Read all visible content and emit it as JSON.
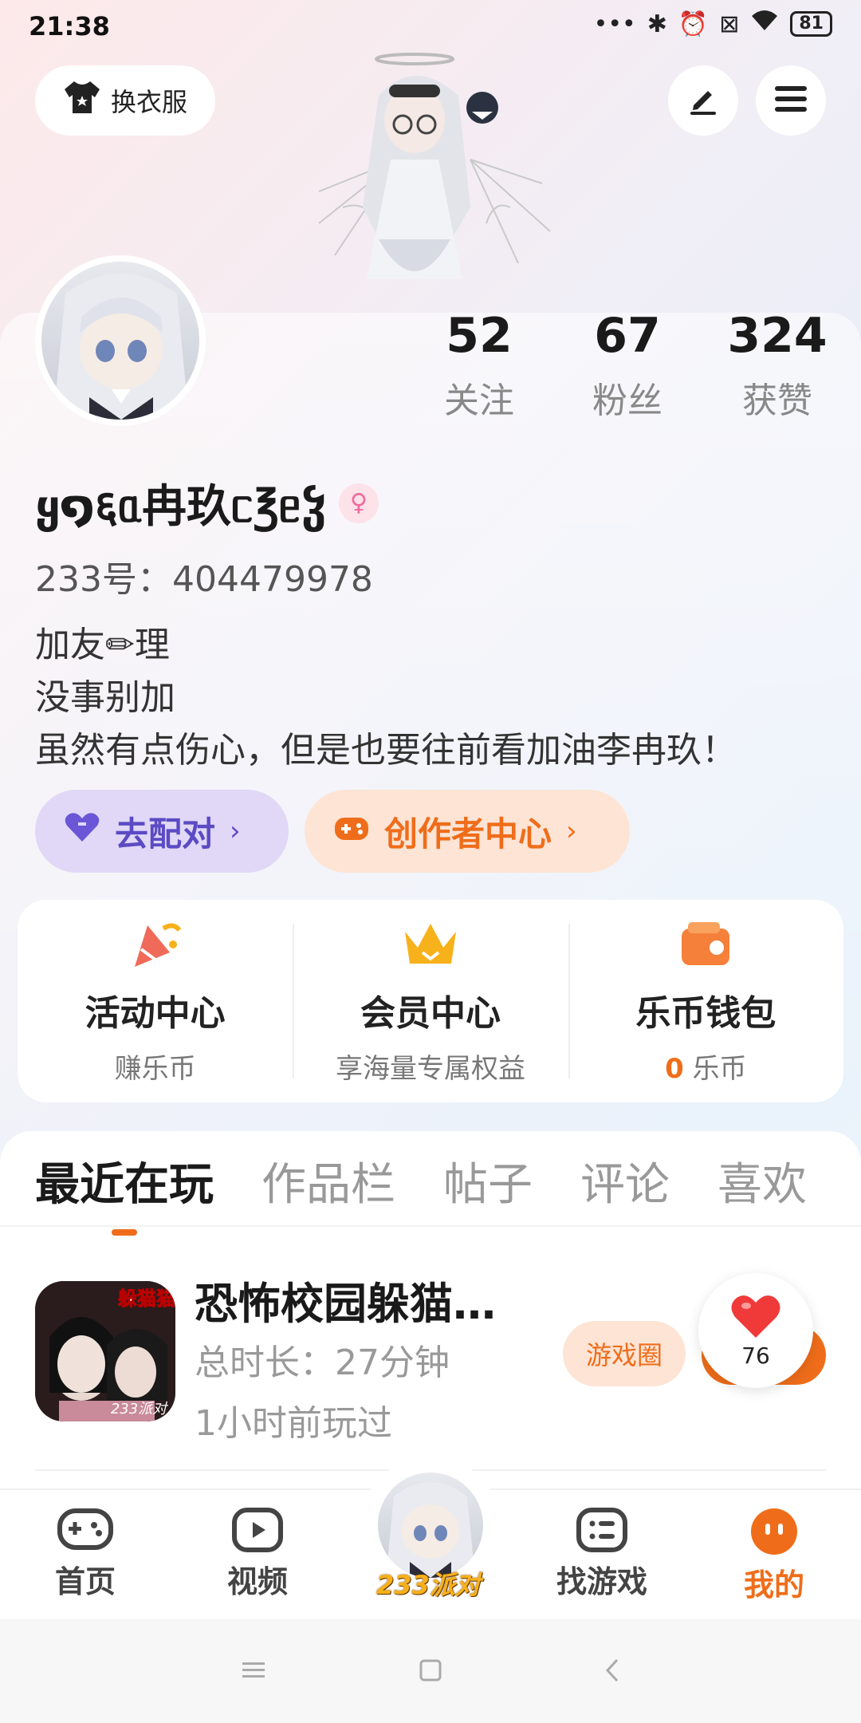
{
  "status_bar": {
    "time": "21:38",
    "dots": "•••",
    "battery": "81"
  },
  "top": {
    "outfit_label": "换衣服"
  },
  "stats": [
    {
      "value": "52",
      "label": "关注"
    },
    {
      "value": "67",
      "label": "粉丝"
    },
    {
      "value": "324",
      "label": "获赞"
    }
  ],
  "profile": {
    "nickname": "ყ໑६ᥲ冉玖ᥴ℥ᥱჴ",
    "gender_symbol": "♀",
    "id_line": "233号：404479978",
    "bio": [
      "加友✏理",
      "没事别加",
      "虽然有点伤心，但是也要往前看加油李冉玖！"
    ]
  },
  "actions": {
    "pair_label": "去配对",
    "creator_label": "创作者中心",
    "chevron": "›"
  },
  "features": [
    {
      "title": "活动中心",
      "sub": "赚乐币"
    },
    {
      "title": "会员中心",
      "sub": "享海量专属权益"
    },
    {
      "title": "乐币钱包",
      "sub_value": "0",
      "sub_unit": "乐币"
    }
  ],
  "tabs": [
    "最近在玩",
    "作品栏",
    "帖子",
    "评论",
    "喜欢"
  ],
  "recent_game": {
    "icon_text": "躲猫猫",
    "icon_watermark": "233派对",
    "title": "恐怖校园躲猫…",
    "total_time": "总时长：27分钟",
    "last_played": "1小时前玩过",
    "circle_label": "游戏圈",
    "like_count": "76"
  },
  "bottom_nav": [
    {
      "label": "首页",
      "active": false
    },
    {
      "label": "视频",
      "active": false
    },
    {
      "label": "233派对",
      "active": false
    },
    {
      "label": "找游戏",
      "active": false
    },
    {
      "label": "我的",
      "active": true
    }
  ],
  "colors": {
    "accent": "#ef6d1a",
    "pair_purple": "#5b4bc4",
    "gender_pink": "#f06a9a"
  }
}
